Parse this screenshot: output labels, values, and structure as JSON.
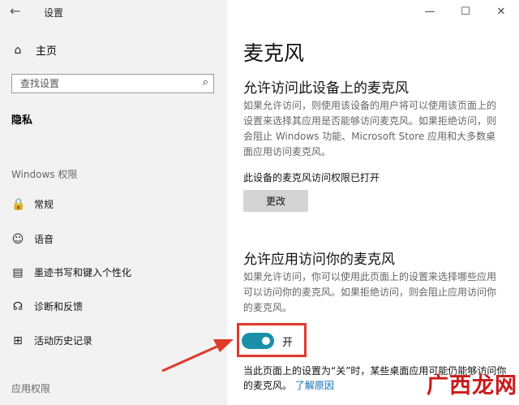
{
  "window": {
    "title": "设置",
    "controls": {
      "minimize": "—",
      "maximize": "☐",
      "close": "✕"
    }
  },
  "sidebar": {
    "home": {
      "label": "主页",
      "icon": "home-icon"
    },
    "search": {
      "placeholder": "查找设置",
      "icon": "search-icon"
    },
    "section": "隐私",
    "windows_permissions_label": "Windows 权限",
    "items": [
      {
        "label": "常规",
        "icon": "lock-icon"
      },
      {
        "label": "语音",
        "icon": "speech-icon"
      },
      {
        "label": "墨迹书写和键入个性化",
        "icon": "ink-icon"
      },
      {
        "label": "诊断和反馈",
        "icon": "feedback-icon"
      },
      {
        "label": "活动历史记录",
        "icon": "history-icon"
      }
    ],
    "app_permissions_label": "应用权限"
  },
  "main": {
    "title": "麦克风",
    "device_section": {
      "heading": "允许访问此设备上的麦克风",
      "description": "如果允许访问，则使用该设备的用户将可以使用该页面上的设置来选择其应用是否能够访问麦克风。如果拒绝访问，则会阻止 Windows 功能、Microsoft Store 应用和大多数桌面应用访问麦克风。",
      "status": "此设备的麦克风访问权限已打开",
      "change_button": "更改"
    },
    "app_section": {
      "heading": "允许应用访问你的麦克风",
      "description": "如果允许访问，你可以使用此页面上的设置来选择哪些应用可以访问你的麦克风。如果拒绝访问，则会阻止应用访问你的麦克风。",
      "toggle_label": "开",
      "toggle_on": true,
      "note": "当此页面上的设置为“关”时，某些桌面应用可能仍能够访问你的麦克风。",
      "learn_more": "了解原因"
    }
  },
  "watermark": "广西龙网",
  "colors": {
    "toggle_on": "#1a90a8",
    "highlight": "#e03a2c",
    "link": "#0c6fb8"
  }
}
